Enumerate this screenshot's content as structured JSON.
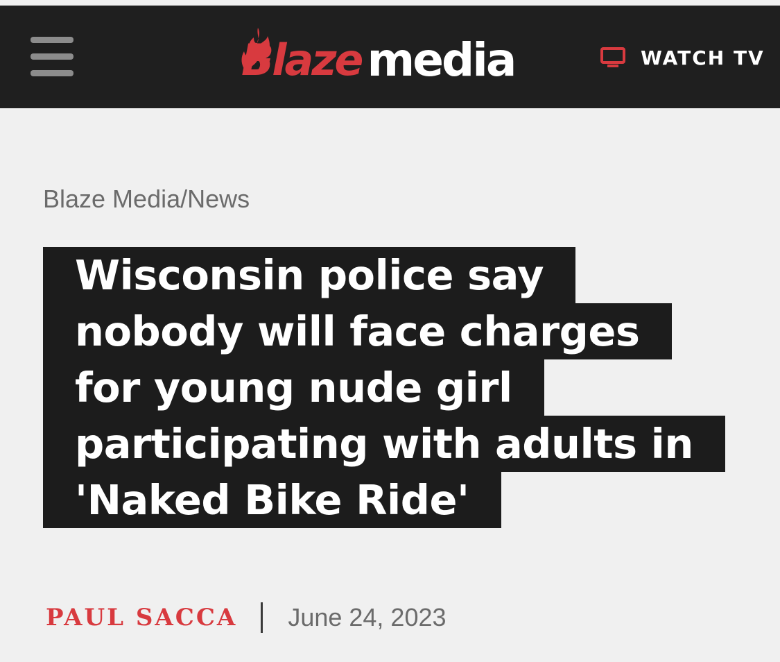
{
  "header": {
    "menu_icon": "hamburger-menu-icon",
    "logo": {
      "part1": "Blaze",
      "part2": "media",
      "brand_color": "#d83a3f"
    },
    "watch_tv": {
      "icon": "tv-monitor-icon",
      "label": "WATCH TV"
    },
    "background": "#1f1f1f"
  },
  "article": {
    "breadcrumb": "Blaze Media/News",
    "headline_lines": [
      "Wisconsin police say",
      "nobody will face charges",
      "for young nude girl",
      "participating with adults in",
      "'Naked Bike Ride'"
    ],
    "author": "PAUL SACCA",
    "date": "June 24, 2023"
  }
}
